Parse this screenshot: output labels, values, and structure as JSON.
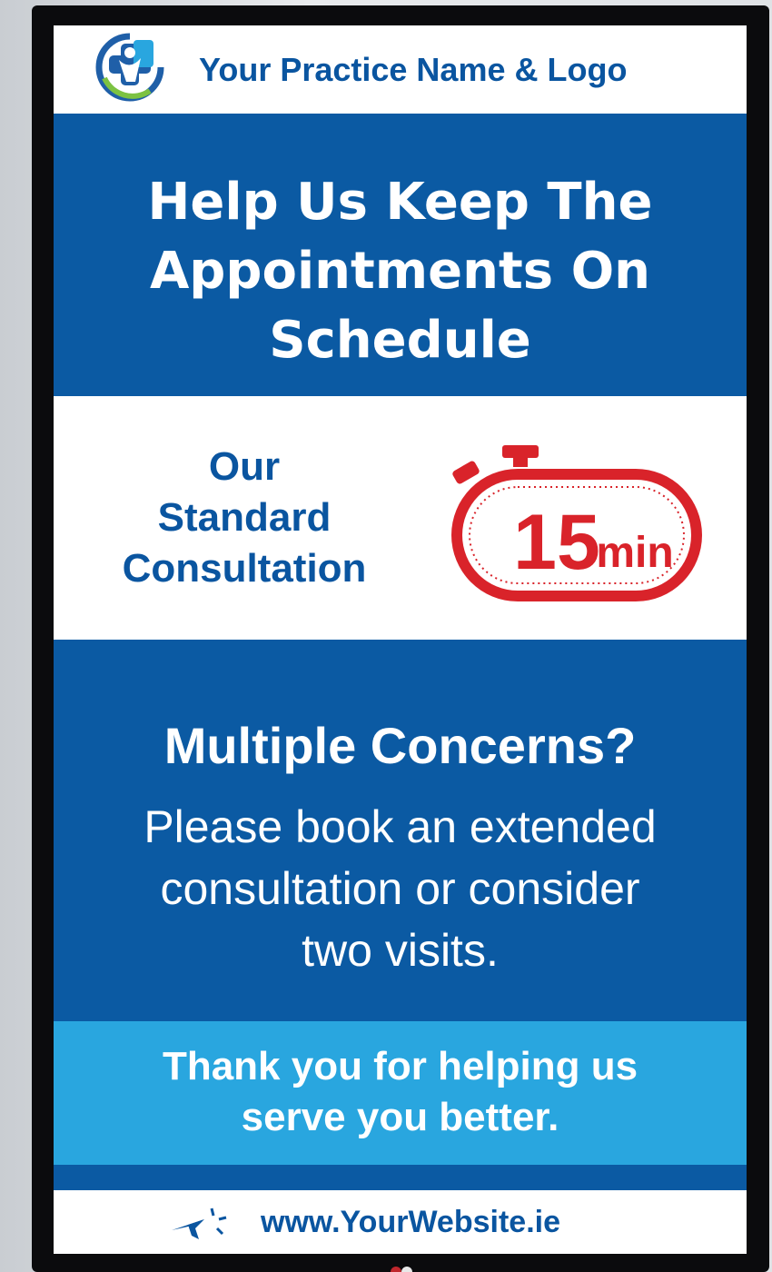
{
  "header": {
    "logo_text": "Your Practice Name & Logo",
    "logo_icon": "medical-cross-person-icon"
  },
  "headline": {
    "line1": "Help Us Keep The",
    "line2": "Appointments On",
    "line3": "Schedule"
  },
  "standard": {
    "line1": "Our",
    "line2": "Standard",
    "line3": "Consultation",
    "timer_icon": "stopwatch-icon",
    "timer_number": "15",
    "timer_unit": "min"
  },
  "multiple": {
    "title": "Multiple Concerns?",
    "line1": "Please book an extended",
    "line2": "consultation or consider",
    "line3": "two visits."
  },
  "thanks": {
    "line1": "Thank you for helping us",
    "line2": "serve you better."
  },
  "footer": {
    "cursor_icon": "cursor-click-icon",
    "website": "www.YourWebsite.ie"
  },
  "colors": {
    "primary_blue": "#0b5aa3",
    "light_blue": "#29a6df",
    "timer_red": "#d9232a",
    "text_blue": "#0a55a0"
  }
}
